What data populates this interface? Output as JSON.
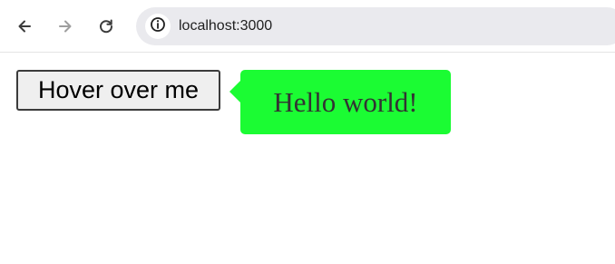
{
  "browser": {
    "url": "localhost:3000",
    "icons": {
      "back": "back-arrow-icon",
      "forward": "forward-arrow-icon",
      "reload": "reload-icon",
      "site_info": "info-icon"
    }
  },
  "page": {
    "button_label": "Hover over me",
    "tooltip_text": "Hello world!"
  },
  "colors": {
    "tooltip_background": "#1bfc33",
    "tooltip_text": "#333333",
    "button_background": "#efefef",
    "button_border": "#3b3b3b",
    "address_bar_background": "#eaeaee"
  }
}
